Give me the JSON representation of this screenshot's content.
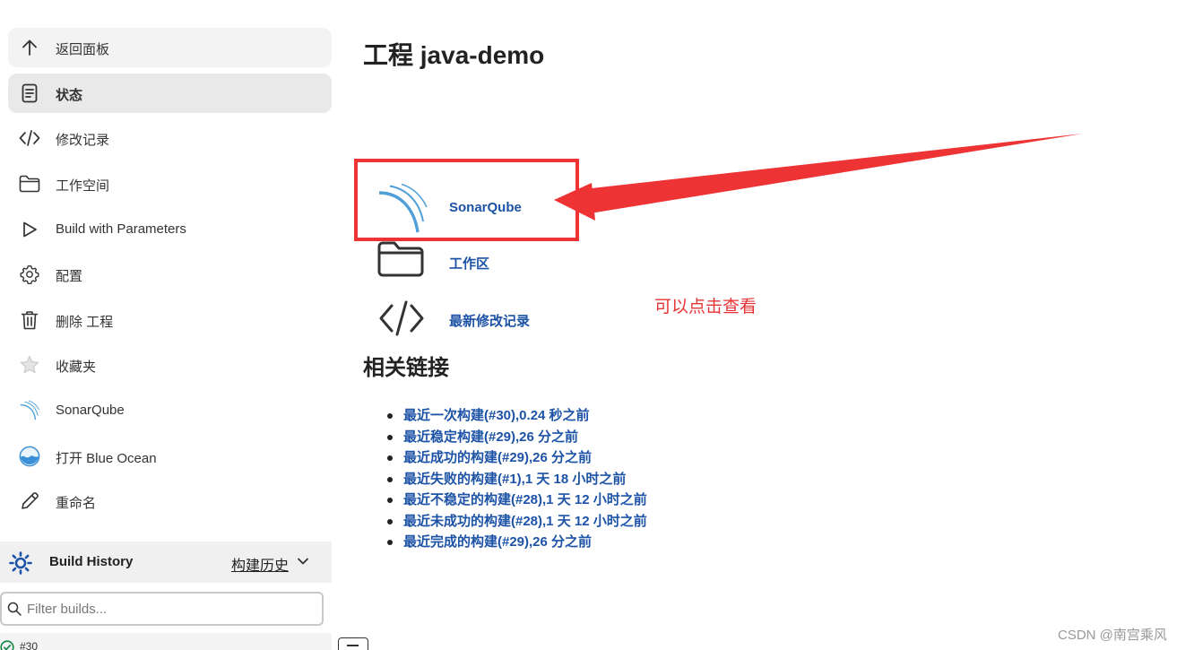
{
  "sidebar": {
    "items": [
      {
        "label": "返回面板",
        "icon": "arrow-up-icon"
      },
      {
        "label": "状态",
        "icon": "document-icon"
      },
      {
        "label": "修改记录",
        "icon": "code-icon"
      },
      {
        "label": "工作空间",
        "icon": "folder-icon"
      },
      {
        "label": "Build with Parameters",
        "icon": "play-icon"
      },
      {
        "label": "配置",
        "icon": "gear-icon"
      },
      {
        "label": "删除 工程",
        "icon": "trash-icon"
      },
      {
        "label": "收藏夹",
        "icon": "star-icon"
      },
      {
        "label": "SonarQube",
        "icon": "sonarqube-icon"
      },
      {
        "label": "打开 Blue Ocean",
        "icon": "blue-ocean-icon"
      },
      {
        "label": "重命名",
        "icon": "pencil-icon"
      }
    ]
  },
  "build_history": {
    "title": "Build History",
    "link": "构建历史",
    "filter_placeholder": "Filter builds...",
    "rows": [
      {
        "number": "#30",
        "status": "success"
      }
    ]
  },
  "main": {
    "title": "工程 java-demo",
    "app_links": [
      {
        "label": "SonarQube",
        "icon": "sonarqube-icon"
      },
      {
        "label": "工作区",
        "icon": "folder-icon"
      },
      {
        "label": "最新修改记录",
        "icon": "code-icon"
      }
    ],
    "section_title": "相关链接",
    "permalinks": [
      "最近一次构建(#30),0.24 秒之前",
      "最近稳定构建(#29),26 分之前",
      "最近成功的构建(#29),26 分之前",
      "最近失败的构建(#1),1 天 18 小时之前",
      "最近不稳定的构建(#28),1 天 12 小时之前",
      "最近未成功的构建(#28),1 天 12 小时之前",
      "最近完成的构建(#29),26 分之前"
    ]
  },
  "annotation": {
    "text": "可以点击查看",
    "color": "#ee3335"
  },
  "watermark": "CSDN @南宫乘风",
  "colors": {
    "link": "#1d53a6",
    "active_bg": "#e9e9ea",
    "sonar_blue": "#4f9fd8"
  }
}
